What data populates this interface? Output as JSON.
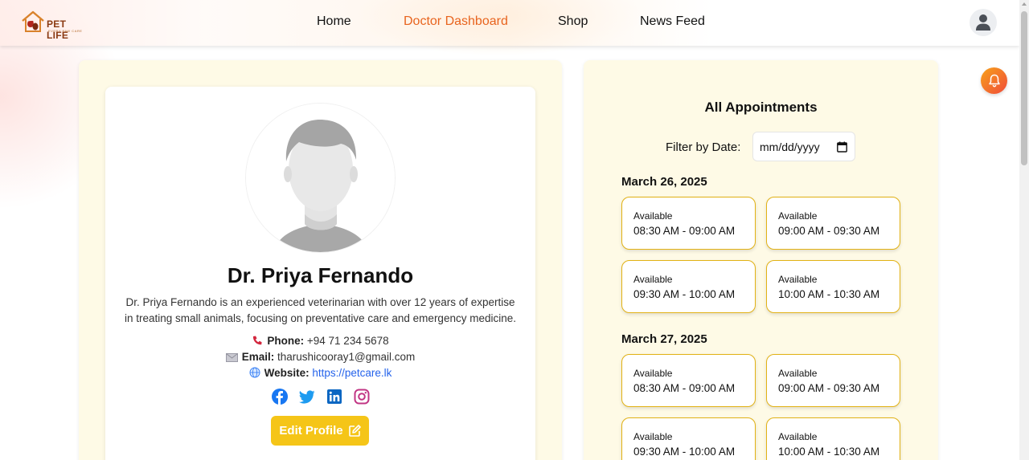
{
  "brand": {
    "logo_text": "PET LIFE",
    "logo_tagline": "EVERY PAW CARE",
    "accent": "#e8641e"
  },
  "nav": {
    "items": [
      {
        "label": "Home",
        "active": false
      },
      {
        "label": "Doctor Dashboard",
        "active": true
      },
      {
        "label": "Shop",
        "active": false
      },
      {
        "label": "News Feed",
        "active": false
      }
    ]
  },
  "profile": {
    "name": "Dr. Priya Fernando",
    "bio": "Dr. Priya Fernando is an experienced veterinarian with over 12 years of expertise in treating small animals, focusing on preventative care and emergency medicine.",
    "phone_label": "Phone:",
    "phone": "+94 71 234 5678",
    "email_label": "Email:",
    "email": "tharushicooray1@gmail.com",
    "website_label": "Website:",
    "website": "https://petcare.lk",
    "socials": [
      "facebook-icon",
      "twitter-icon",
      "linkedin-icon",
      "instagram-icon"
    ],
    "edit_label": "Edit Profile"
  },
  "appointments": {
    "title": "All Appointments",
    "filter_label": "Filter by Date:",
    "date_placeholder": "mm/dd/yyyy",
    "days": [
      {
        "date": "March 26, 2025",
        "slots": [
          {
            "status": "Available",
            "time": "08:30 AM - 09:00 AM"
          },
          {
            "status": "Available",
            "time": "09:00 AM - 09:30 AM"
          },
          {
            "status": "Available",
            "time": "09:30 AM - 10:00 AM"
          },
          {
            "status": "Available",
            "time": "10:00 AM - 10:30 AM"
          }
        ]
      },
      {
        "date": "March 27, 2025",
        "slots": [
          {
            "status": "Available",
            "time": "08:30 AM - 09:00 AM"
          },
          {
            "status": "Available",
            "time": "09:00 AM - 09:30 AM"
          },
          {
            "status": "Available",
            "time": "09:30 AM - 10:00 AM"
          },
          {
            "status": "Available",
            "time": "10:00 AM - 10:30 AM"
          }
        ]
      }
    ]
  },
  "colors": {
    "panel_bg": "#fefae6",
    "slot_border": "#e2b215",
    "edit_button": "#f5c518",
    "link": "#2563eb"
  }
}
